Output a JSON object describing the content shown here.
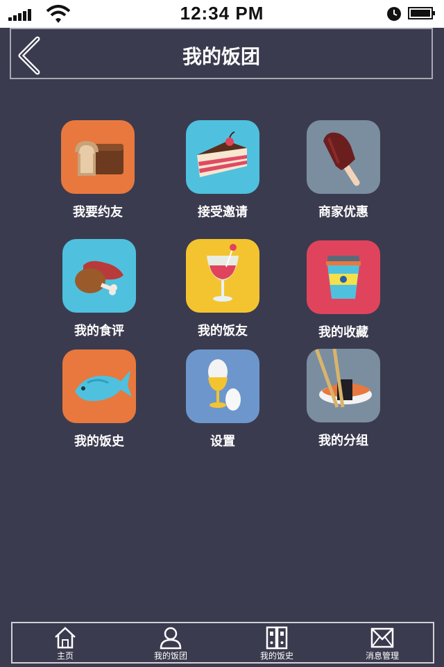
{
  "status": {
    "time": "12:34 PM"
  },
  "header": {
    "title": "我的饭团",
    "back_icon": "chevron-left-icon"
  },
  "grid": [
    {
      "label": "我要约友",
      "icon": "bread-icon",
      "bg": "#e8783e"
    },
    {
      "label": "接受邀请",
      "icon": "cake-icon",
      "bg": "#4fc1de"
    },
    {
      "label": "商家优惠",
      "icon": "popsicle-icon",
      "bg": "#7a8ea0"
    },
    {
      "label": "我的食评",
      "icon": "drumstick-icon",
      "bg": "#4fc1de"
    },
    {
      "label": "我的饭友",
      "icon": "cocktail-icon",
      "bg": "#f4c430"
    },
    {
      "label": "我的收藏",
      "icon": "coffee-cup-icon",
      "bg": "#e0445d"
    },
    {
      "label": "我的饭史",
      "icon": "fish-icon",
      "bg": "#e8783e"
    },
    {
      "label": "设置",
      "icon": "egg-icon",
      "bg": "#6d97cc"
    },
    {
      "label": "我的分组",
      "icon": "sushi-icon",
      "bg": "#7a8ea0"
    }
  ],
  "tabbar": [
    {
      "label": "主页",
      "icon": "home-icon"
    },
    {
      "label": "我的饭团",
      "icon": "user-icon"
    },
    {
      "label": "我的饭史",
      "icon": "binders-icon"
    },
    {
      "label": "消息管理",
      "icon": "mail-icon"
    }
  ]
}
